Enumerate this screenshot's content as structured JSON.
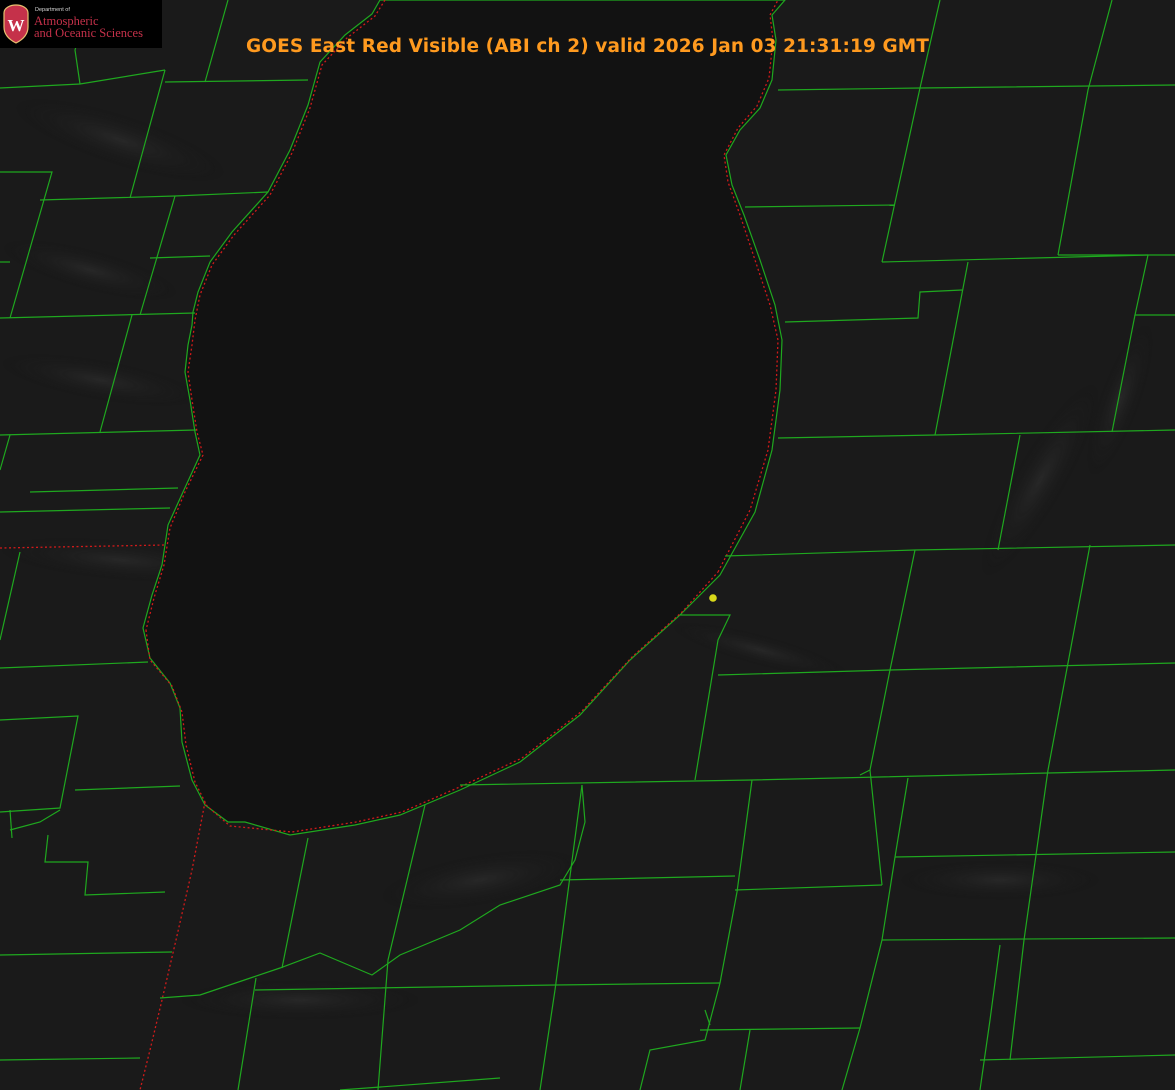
{
  "title": "GOES East Red Visible (ABI ch 2) valid 2026 Jan 03 21:31:19 GMT",
  "logo": {
    "department": "Department of",
    "name_line1": "Atmospheric",
    "name_line2": "and Oceanic Sciences",
    "shield_letter": "W"
  },
  "colors": {
    "background": "#0b0b0b",
    "lake": "#121212",
    "county_lines": "#1fa81f",
    "state_lines": "#d11a1a",
    "title": "#ff9a1f",
    "marker": "#d9d91a",
    "logo_red": "#c5314a"
  },
  "icons": {
    "logo_shield": "uw-crest-icon",
    "station_marker": "yellow-dot-icon"
  }
}
